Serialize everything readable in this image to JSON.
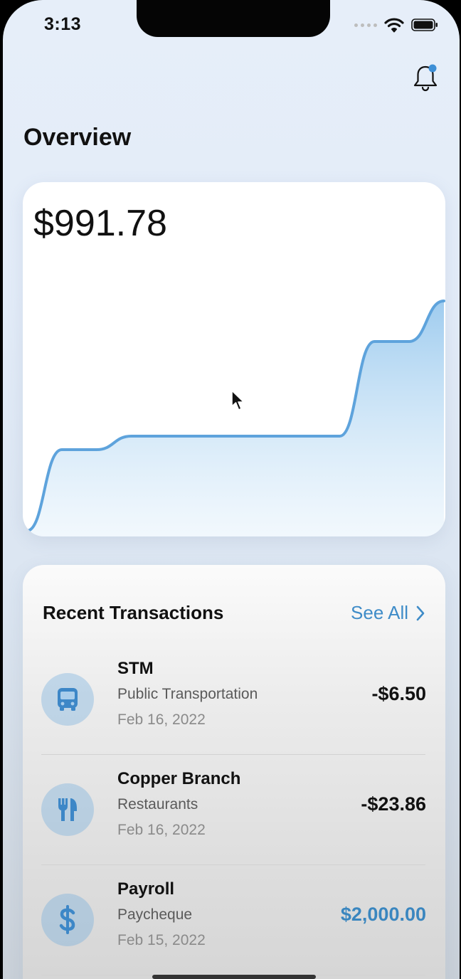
{
  "status_bar": {
    "time": "3:13"
  },
  "header": {
    "title": "Overview",
    "notification_dot_color": "#3d8fd6"
  },
  "balance_card": {
    "amount": "$991.78"
  },
  "chart_data": {
    "type": "area",
    "title": "",
    "xlabel": "",
    "ylabel": "",
    "grid": false,
    "color": "#5ea3dc",
    "x": [
      0,
      1,
      2,
      3,
      4,
      5,
      6,
      7,
      8,
      9,
      10,
      11,
      12
    ],
    "values": [
      0,
      120,
      120,
      140,
      140,
      140,
      140,
      140,
      140,
      140,
      280,
      280,
      340
    ],
    "ylim": [
      0,
      400
    ]
  },
  "transactions": {
    "title": "Recent Transactions",
    "see_all_label": "See All",
    "items": [
      {
        "name": "STM",
        "category": "Public Transportation",
        "date": "Feb 16, 2022",
        "amount": "-$6.50",
        "icon": "bus-icon",
        "credit": false
      },
      {
        "name": "Copper Branch",
        "category": "Restaurants",
        "date": "Feb 16, 2022",
        "amount": "-$23.86",
        "icon": "fork-knife-icon",
        "credit": false
      },
      {
        "name": "Payroll",
        "category": "Paycheque",
        "date": "Feb 15, 2022",
        "amount": "$2,000.00",
        "icon": "dollar-icon",
        "credit": true
      }
    ]
  },
  "colors": {
    "accent": "#3f8cc8",
    "icon_bg": "#a9cdeb",
    "icon_fg": "#3d87c7"
  }
}
